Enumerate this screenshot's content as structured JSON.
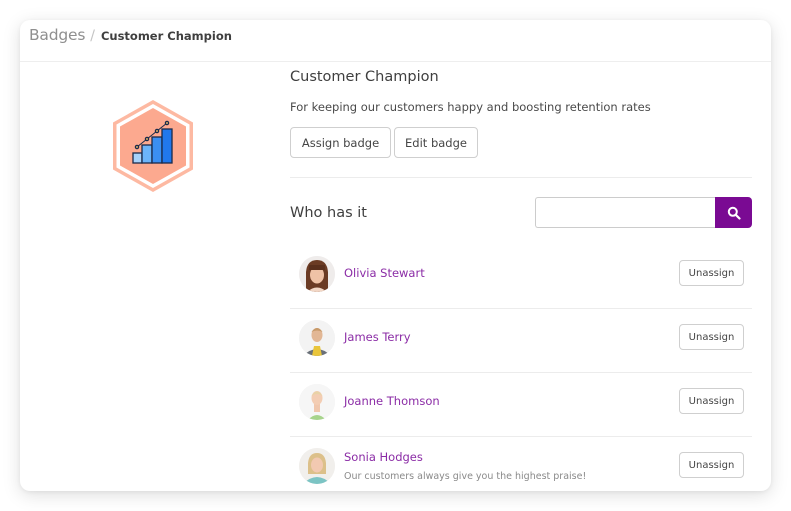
{
  "breadcrumb": {
    "root": "Badges",
    "separator": "/",
    "current": "Customer Champion"
  },
  "badge": {
    "icon": "bar-chart-growth-icon",
    "title": "Customer Champion",
    "description": "For keeping our customers happy and boosting retention rates",
    "assign_label": "Assign badge",
    "edit_label": "Edit badge",
    "colors": {
      "hexagon_fill": "#fca98f",
      "hexagon_ring": "#fdb9a2",
      "bars": [
        "#a6d2fb",
        "#6cb4fa",
        "#3b8ff2",
        "#2178ec"
      ]
    }
  },
  "holders": {
    "heading": "Who has it",
    "search": {
      "placeholder": "",
      "value": "",
      "button_icon": "search-icon"
    },
    "accent": "#7a0a93",
    "name_color": "#8b2ca6",
    "people": [
      {
        "name": "Olivia Stewart",
        "note": "",
        "action": "Unassign"
      },
      {
        "name": "James Terry",
        "note": "",
        "action": "Unassign"
      },
      {
        "name": "Joanne Thomson",
        "note": "",
        "action": "Unassign"
      },
      {
        "name": "Sonia Hodges",
        "note": "Our customers always give you the highest praise!",
        "action": "Unassign"
      }
    ]
  }
}
